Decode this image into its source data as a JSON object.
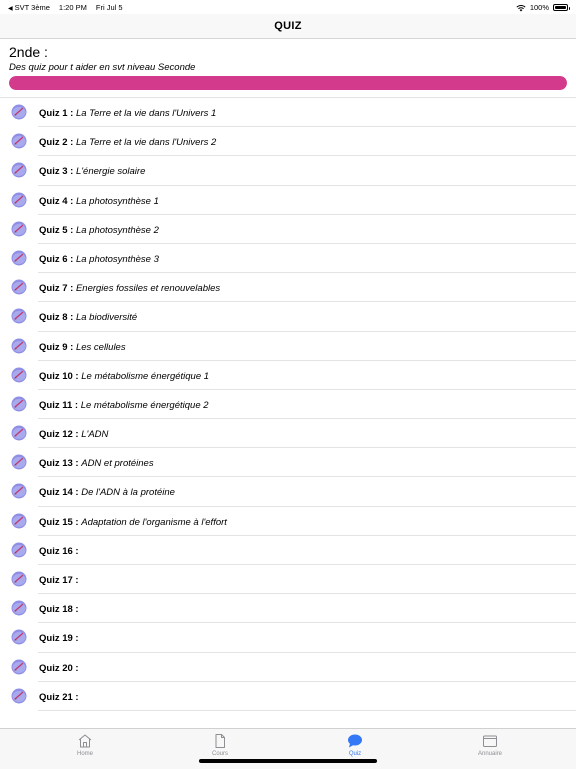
{
  "status_bar": {
    "back_app": "SVT 3ème",
    "time": "1:20 PM",
    "date": "Fri Jul 5",
    "battery": "100%"
  },
  "nav": {
    "title": "QUIZ"
  },
  "header": {
    "level": "2nde :",
    "description": "Des quiz pour t aider en svt niveau Seconde",
    "progress_fraction": 1.0
  },
  "quizzes": [
    {
      "num": "Quiz 1 :",
      "name": "La Terre et la vie dans l'Univers 1"
    },
    {
      "num": "Quiz 2 :",
      "name": "La Terre et la vie dans l'Univers 2"
    },
    {
      "num": "Quiz 3 :",
      "name": "L'énergie solaire"
    },
    {
      "num": "Quiz 4 :",
      "name": "La photosynthèse 1"
    },
    {
      "num": "Quiz 5 :",
      "name": "La photosynthèse 2"
    },
    {
      "num": "Quiz 6 :",
      "name": "La photosynthèse 3"
    },
    {
      "num": "Quiz 7 :",
      "name": "Energies fossiles et renouvelables"
    },
    {
      "num": "Quiz 8 :",
      "name": "La biodiversité"
    },
    {
      "num": "Quiz 9 :",
      "name": "Les cellules"
    },
    {
      "num": "Quiz 10 :",
      "name": "Le métabolisme énergétique 1"
    },
    {
      "num": "Quiz 11 :",
      "name": "Le métabolisme énergétique 2"
    },
    {
      "num": "Quiz 12 :",
      "name": "L'ADN"
    },
    {
      "num": "Quiz 13 :",
      "name": "ADN et protéines"
    },
    {
      "num": "Quiz 14 :",
      "name": "De l'ADN à la protéine"
    },
    {
      "num": "Quiz 15 :",
      "name": "Adaptation de l'organisme à l'effort"
    },
    {
      "num": "Quiz 16 :",
      "name": ""
    },
    {
      "num": "Quiz 17 :",
      "name": ""
    },
    {
      "num": "Quiz 18 :",
      "name": ""
    },
    {
      "num": "Quiz 19 :",
      "name": ""
    },
    {
      "num": "Quiz 20 :",
      "name": ""
    },
    {
      "num": "Quiz 21 :",
      "name": ""
    }
  ],
  "tabs": [
    {
      "label": "Home",
      "icon": "home-icon",
      "active": false
    },
    {
      "label": "Cours",
      "icon": "document-icon",
      "active": false
    },
    {
      "label": "Quiz",
      "icon": "chat-bubble-icon",
      "active": true
    },
    {
      "label": "Annuaire",
      "icon": "folder-icon",
      "active": false
    }
  ],
  "colors": {
    "accent": "#3478f6",
    "progress": "#d43a8c",
    "quiz_icon": "#8f8fe6"
  }
}
